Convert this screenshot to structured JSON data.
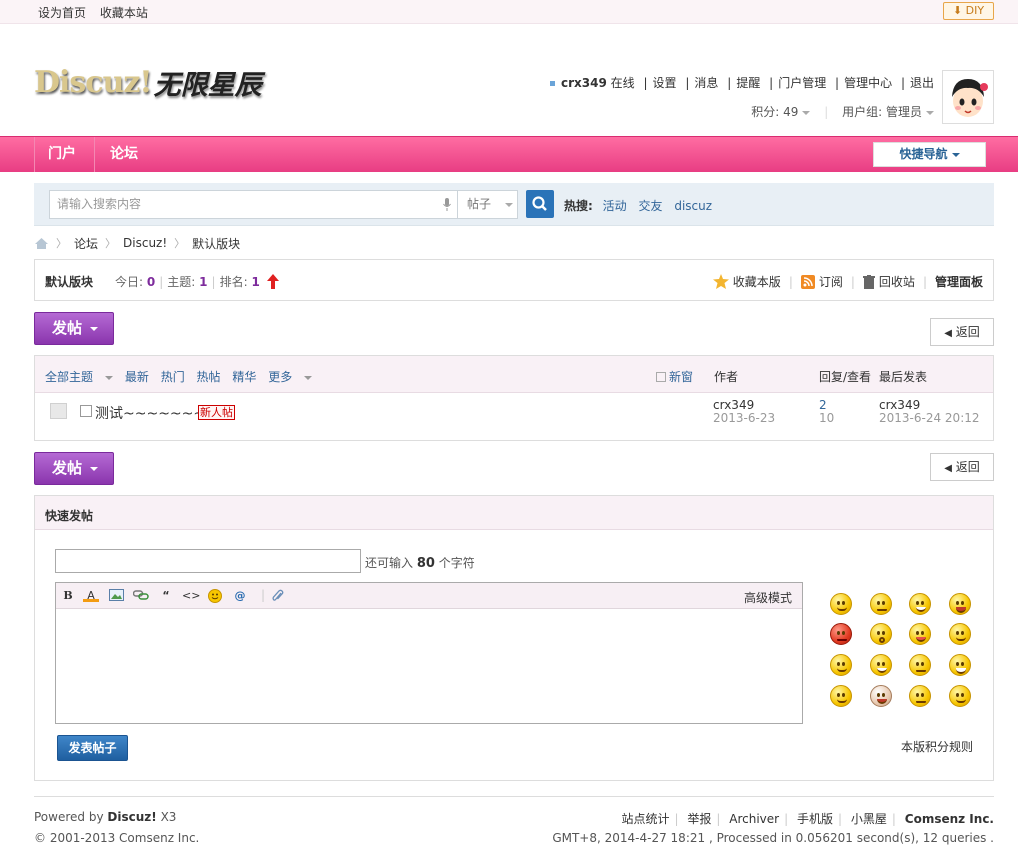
{
  "topbar": {
    "set_home": "设为首页",
    "bookmark": "收藏本站",
    "diy": "DIY"
  },
  "logo": {
    "text_en": "Discuz!",
    "text_cn": "无限星辰"
  },
  "user": {
    "name": "crx349",
    "status": "在线",
    "links": [
      "设置",
      "消息",
      "提醒",
      "门户管理",
      "管理中心",
      "退出"
    ],
    "credits_label": "积分: 49",
    "group_label": "用户组: 管理员"
  },
  "nav": {
    "items": [
      "门户",
      "论坛"
    ],
    "quick_nav": "快捷导航"
  },
  "search": {
    "placeholder": "请输入搜索内容",
    "type": "帖子",
    "hot_label": "热搜:",
    "hot_keywords": [
      "活动",
      "交友",
      "discuz"
    ]
  },
  "breadcrumb": [
    "论坛",
    "Discuz!",
    "默认版块"
  ],
  "forum": {
    "name": "默认版块",
    "today_label": "今日:",
    "today": "0",
    "threads_label": "主题:",
    "threads": "1",
    "rank_label": "排名:",
    "rank": "1",
    "actions": [
      "收藏本版",
      "订阅",
      "回收站",
      "管理面板"
    ]
  },
  "buttons": {
    "post": "发帖",
    "back": "返回"
  },
  "thread_list": {
    "filters": [
      "全部主题",
      "最新",
      "热门",
      "热帖",
      "精华",
      "更多"
    ],
    "new_window": "新窗",
    "columns": [
      "作者",
      "回复/查看",
      "最后发表"
    ],
    "rows": [
      {
        "title": "测试~~~~~~~",
        "tag": "新人帖",
        "author": "crx349",
        "date": "2013-6-23",
        "replies": "2",
        "views": "10",
        "last_user": "crx349",
        "last_time": "2013-6-24 20:12"
      }
    ]
  },
  "quick_post": {
    "title": "快速发帖",
    "remain_prefix": "还可输入",
    "remain_count": "80",
    "remain_suffix": "个字符",
    "advanced_mode": "高级模式",
    "submit": "发表帖子",
    "credit_rules": "本版积分规则"
  },
  "footer": {
    "powered_prefix": "Powered by",
    "powered_brand": "Discuz!",
    "powered_version": "X3",
    "copyright": "© 2001-2013 Comsenz Inc.",
    "links": [
      "站点统计",
      "举报",
      "Archiver",
      "手机版",
      "小黑屋"
    ],
    "company": "Comsenz Inc.",
    "stats": "GMT+8, 2014-4-27 18:21 , Processed in 0.056201 second(s), 12 queries ."
  },
  "colors": {
    "nav_pink": "#e83d83",
    "post_purple": "#8a35ad",
    "link_blue": "#336699",
    "submit_blue": "#1f5fa0"
  }
}
